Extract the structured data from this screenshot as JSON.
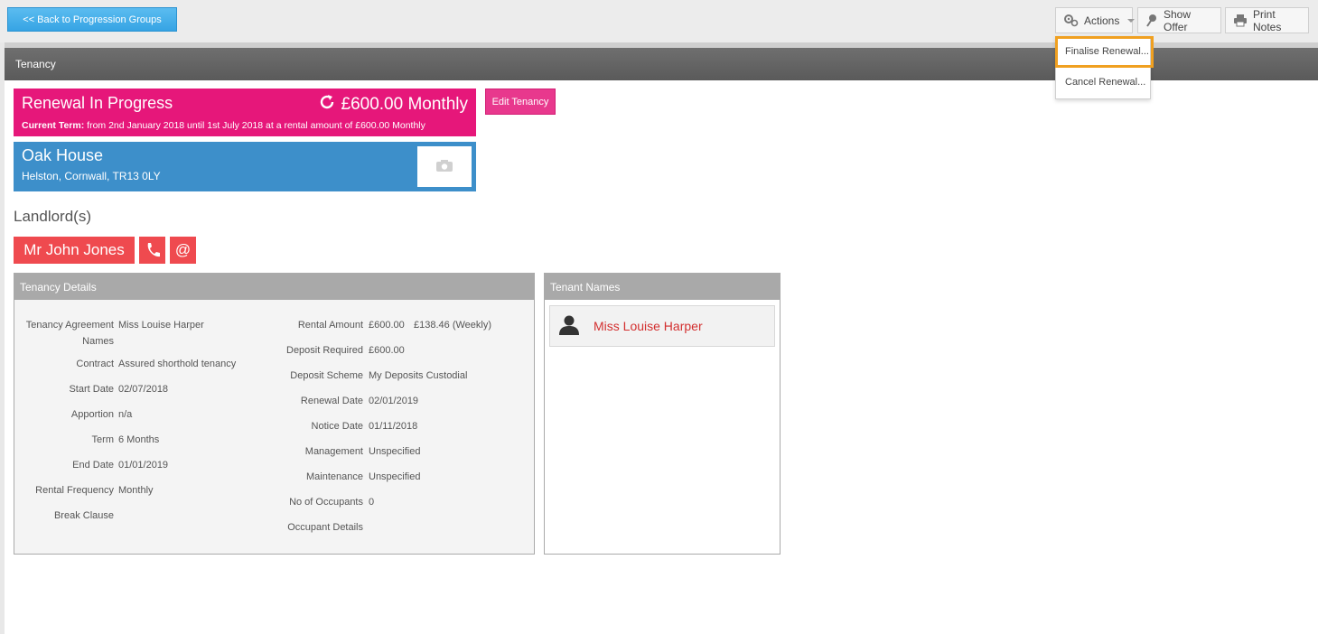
{
  "toolbar": {
    "back_label": "<< Back to Progression Groups",
    "actions_label": "Actions",
    "show_offer_label": "Show Offer",
    "print_notes_label": "Print Notes"
  },
  "actions_menu": {
    "items": [
      "Finalise Renewal...",
      "Cancel Renewal..."
    ]
  },
  "section_title": "Tenancy",
  "status": {
    "title": "Renewal In Progress",
    "amount": "£600.00 Monthly",
    "term_label": "Current Term:",
    "term_text": "from 2nd January 2018 until 1st July 2018 at a rental amount of £600.00 Monthly",
    "color": "#e6177a"
  },
  "edit_tenancy_label": "Edit Tenancy",
  "property": {
    "name": "Oak House",
    "address": "Helston, Cornwall, TR13 0LY",
    "color": "#3d8fca"
  },
  "landlords": {
    "heading": "Landlord(s)",
    "name": "Mr John Jones",
    "email_glyph": "@"
  },
  "details_panel": {
    "title": "Tenancy Details",
    "left": [
      {
        "label": "Tenancy Agreement Names",
        "value": "Miss Louise Harper"
      },
      {
        "label": "Contract",
        "value": "Assured shorthold tenancy"
      },
      {
        "label": "Start Date",
        "value": "02/07/2018"
      },
      {
        "label": "Apportion",
        "value": "n/a"
      },
      {
        "label": "Term",
        "value": "6 Months"
      },
      {
        "label": "End Date",
        "value": "01/01/2019"
      },
      {
        "label": "Rental Frequency",
        "value": "Monthly"
      },
      {
        "label": "Break Clause",
        "value": ""
      }
    ],
    "right": [
      {
        "label": "Rental Amount",
        "value": "£600.00",
        "extra": "£138.46 (Weekly)"
      },
      {
        "label": "Deposit Required",
        "value": "£600.00"
      },
      {
        "label": "Deposit Scheme",
        "value": "My Deposits Custodial"
      },
      {
        "label": "Renewal Date",
        "value": "02/01/2019"
      },
      {
        "label": "Notice Date",
        "value": "01/11/2018"
      },
      {
        "label": "Management",
        "value": "Unspecified"
      },
      {
        "label": "Maintenance",
        "value": "Unspecified"
      },
      {
        "label": "No of Occupants",
        "value": "0"
      },
      {
        "label": "Occupant Details",
        "value": ""
      }
    ]
  },
  "tenants_panel": {
    "title": "Tenant Names",
    "tenants": [
      "Miss Louise Harper"
    ]
  }
}
